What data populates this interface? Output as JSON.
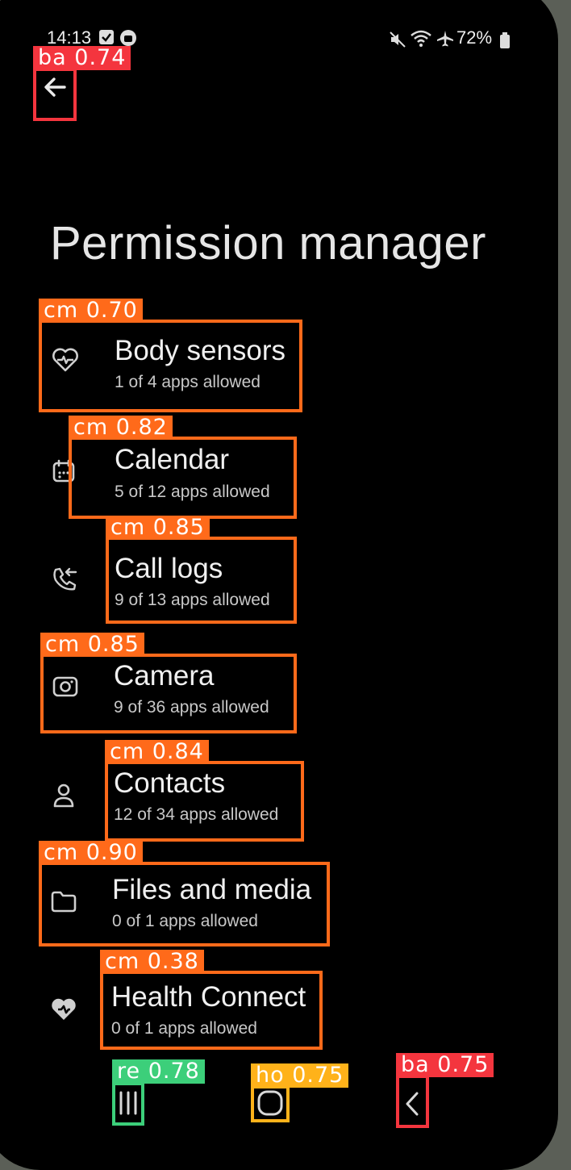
{
  "status": {
    "time": "14:13",
    "battery": "72%"
  },
  "page": {
    "title": "Permission manager"
  },
  "permissions": [
    {
      "label": "Body sensors",
      "sub": "1 of 4 apps allowed",
      "icon": "heart-pulse-icon"
    },
    {
      "label": "Calendar",
      "sub": "5 of 12 apps allowed",
      "icon": "calendar-icon"
    },
    {
      "label": "Call logs",
      "sub": "9 of 13 apps allowed",
      "icon": "call-log-icon"
    },
    {
      "label": "Camera",
      "sub": "9 of 36 apps allowed",
      "icon": "camera-icon"
    },
    {
      "label": "Contacts",
      "sub": "12 of 34 apps allowed",
      "icon": "person-icon"
    },
    {
      "label": "Files and media",
      "sub": "0 of 1 apps allowed",
      "icon": "folder-icon"
    },
    {
      "label": "Health Connect",
      "sub": "0 of 1 apps allowed",
      "icon": "health-connect-icon"
    }
  ],
  "detections": [
    {
      "tag": "ba 0.74",
      "color": "#f4353e"
    },
    {
      "tag": "cm 0.70",
      "color": "#ff6a1a"
    },
    {
      "tag": "cm 0.82",
      "color": "#ff6a1a"
    },
    {
      "tag": "cm 0.85",
      "color": "#ff6a1a"
    },
    {
      "tag": "cm 0.85",
      "color": "#ff6a1a"
    },
    {
      "tag": "cm 0.84",
      "color": "#ff6a1a"
    },
    {
      "tag": "cm 0.90",
      "color": "#ff6a1a"
    },
    {
      "tag": "cm 0.38",
      "color": "#ff6a1a"
    },
    {
      "tag": "re 0.78",
      "color": "#3ccf7a"
    },
    {
      "tag": "ho 0.75",
      "color": "#ffb21a"
    },
    {
      "tag": "ba 0.75",
      "color": "#f4353e"
    }
  ]
}
